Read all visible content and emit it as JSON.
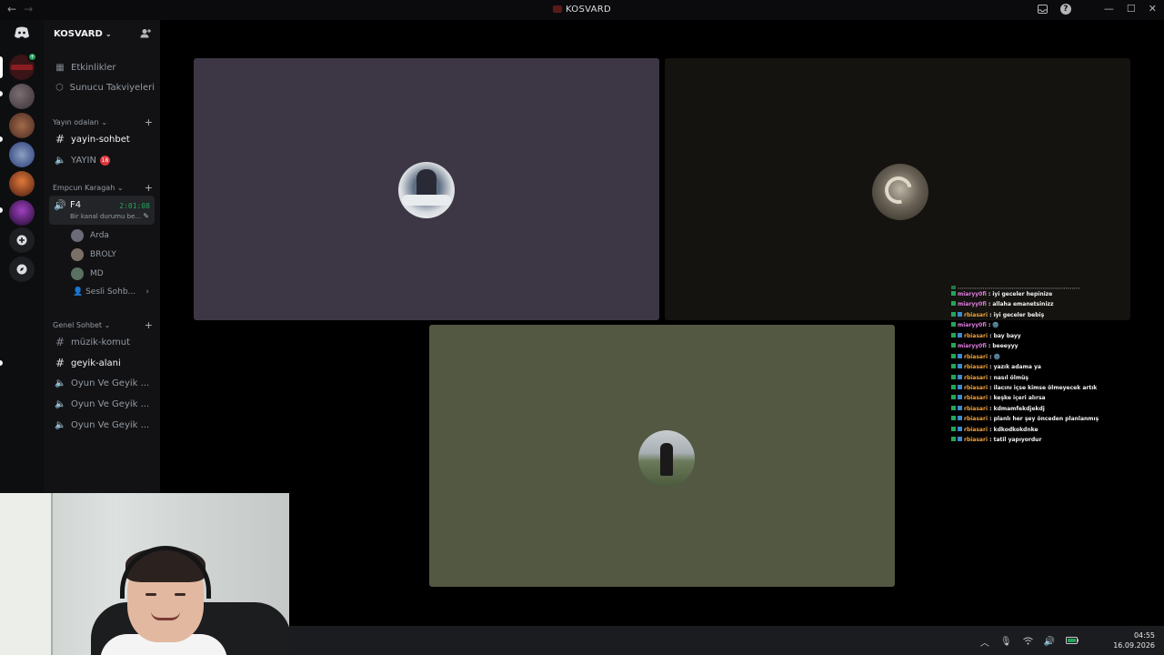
{
  "window": {
    "title": "KOSVARD",
    "nav_back": "←",
    "nav_forward": "→",
    "min": "—",
    "max": "☐",
    "close": "✕",
    "inbox_icon": "inbox-icon",
    "help": "?"
  },
  "server": {
    "name": "KOSVARD",
    "top_items": [
      {
        "label": "Etkinlikler",
        "icon": "calendar-icon"
      },
      {
        "label": "Sunucu Takviyeleri",
        "icon": "boost-icon"
      }
    ],
    "categories": [
      {
        "label": "Yayın odaları"
      },
      {
        "label": "Empcun Karagah"
      },
      {
        "label": "Genel Sohbet"
      }
    ],
    "yayin_channels": [
      {
        "label": "yayin-sohbet",
        "type": "text"
      },
      {
        "label": "YAYIN",
        "type": "voice",
        "badge": "18"
      }
    ],
    "voice_active": {
      "name": "F4",
      "timer": "2:01:08",
      "status": "Bir kanal durumu be..."
    },
    "members": [
      {
        "name": "Arda"
      },
      {
        "name": "BROLY"
      },
      {
        "name": "MD"
      }
    ],
    "sesli": "Sesli Sohb...",
    "genel_channels": [
      {
        "label": "müzik-komut",
        "type": "text"
      },
      {
        "label": "geyik-alani",
        "type": "text"
      },
      {
        "label": "Oyun Ve Geyik ...",
        "type": "voice"
      },
      {
        "label": "Oyun Ve Geyik ...",
        "type": "voice"
      },
      {
        "label": "Oyun Ve Geyik ...",
        "type": "voice"
      }
    ]
  },
  "chat_overlay": [
    {
      "user": "miaryy0fi",
      "text": ": iyi geceler hepinize"
    },
    {
      "user": "miaryy0fi",
      "text": ": allaha emanetsinizz"
    },
    {
      "user": "rbiasari",
      "text": ": iyi geceler bebiş"
    },
    {
      "user": "miaryy0fi",
      "text": ": 🌚"
    },
    {
      "user": "rbiasari",
      "text": ": bay bayy"
    },
    {
      "user": "miaryy0fi",
      "text": ": beeeyyy"
    },
    {
      "user": "rbiasari",
      "text": ": 🌚"
    },
    {
      "user": "rbiasari",
      "text": ": yazık adama ya"
    },
    {
      "user": "rbiasari",
      "text": ": nasıl ölmüş"
    },
    {
      "user": "rbiasari",
      "text": ": ilacını içse kimse ölmeyecek artık"
    },
    {
      "user": "rbiasari",
      "text": ": keşke içeri alırsa"
    },
    {
      "user": "rbiasari",
      "text": ": kdmamfekdjekdj"
    },
    {
      "user": "rbiasari",
      "text": ": planlı her şey önceden planlanmış"
    },
    {
      "user": "rbiasari",
      "text": ": kdkodkokdnke"
    },
    {
      "user": "rbiasari",
      "text": ": tatil yapıyordur"
    }
  ],
  "taskbar": {
    "time": "04:55",
    "date": "16.09.2026"
  },
  "colors": {
    "background": "#000000",
    "sidebar": "#121214",
    "tile_purple": "#3d3745",
    "tile_dark": "#14130f",
    "tile_green": "#535843",
    "accent_green": "#23a55a"
  }
}
